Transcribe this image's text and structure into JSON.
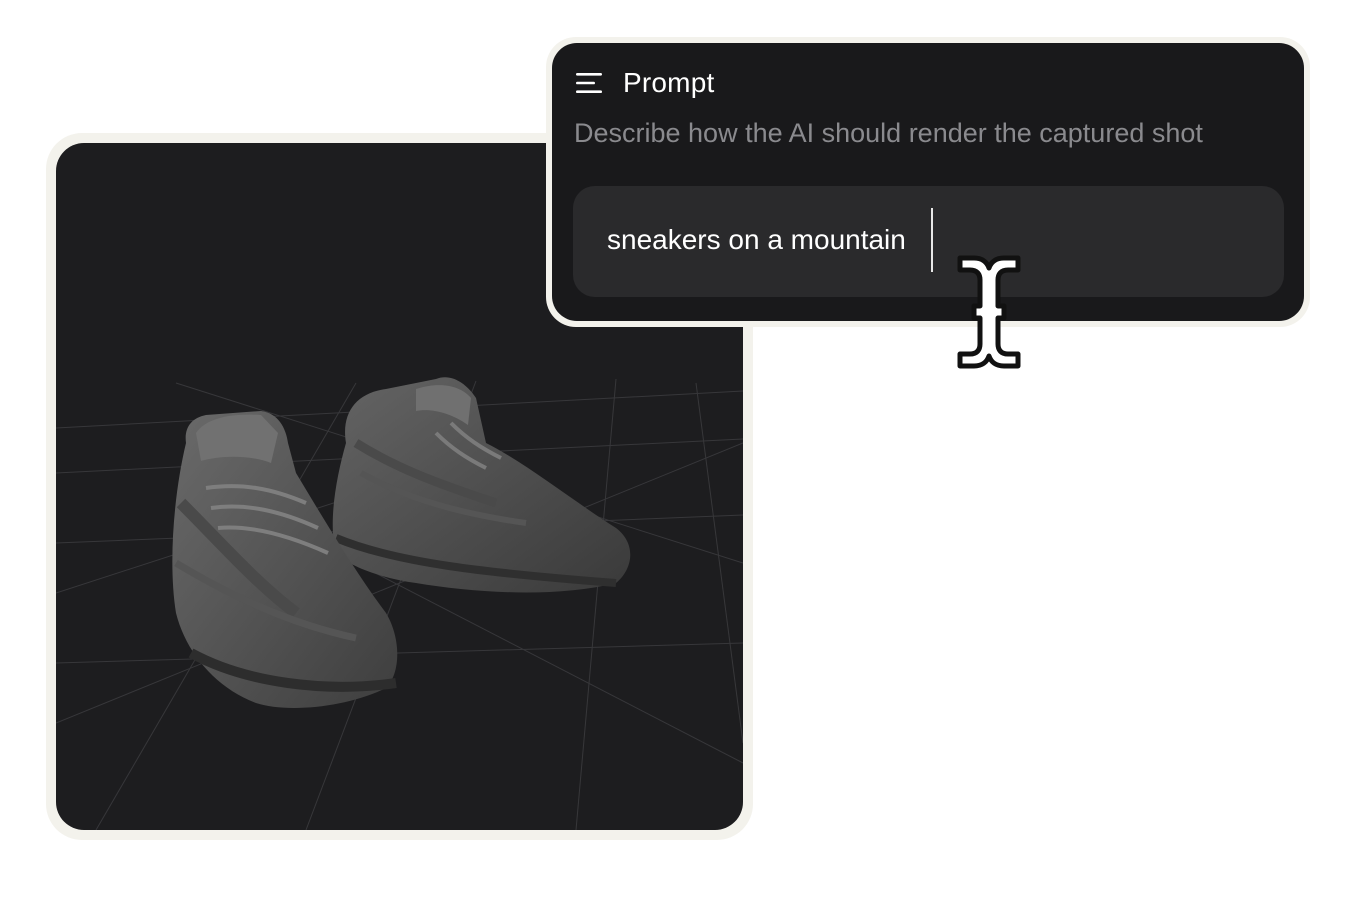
{
  "prompt_panel": {
    "menu_icon": "menu-icon",
    "title": "Prompt",
    "description": "Describe how the AI should render the captured shot",
    "input_value": "sneakers on a mountain"
  },
  "viewport": {
    "subject": "3d-sneakers-model",
    "background_color": "#1d1d1f"
  },
  "cursor": {
    "icon": "text-cursor-icon"
  },
  "colors": {
    "panel_bg": "#19191b",
    "input_bg": "#2a2a2c",
    "frame_bg": "#f3f2ec"
  }
}
